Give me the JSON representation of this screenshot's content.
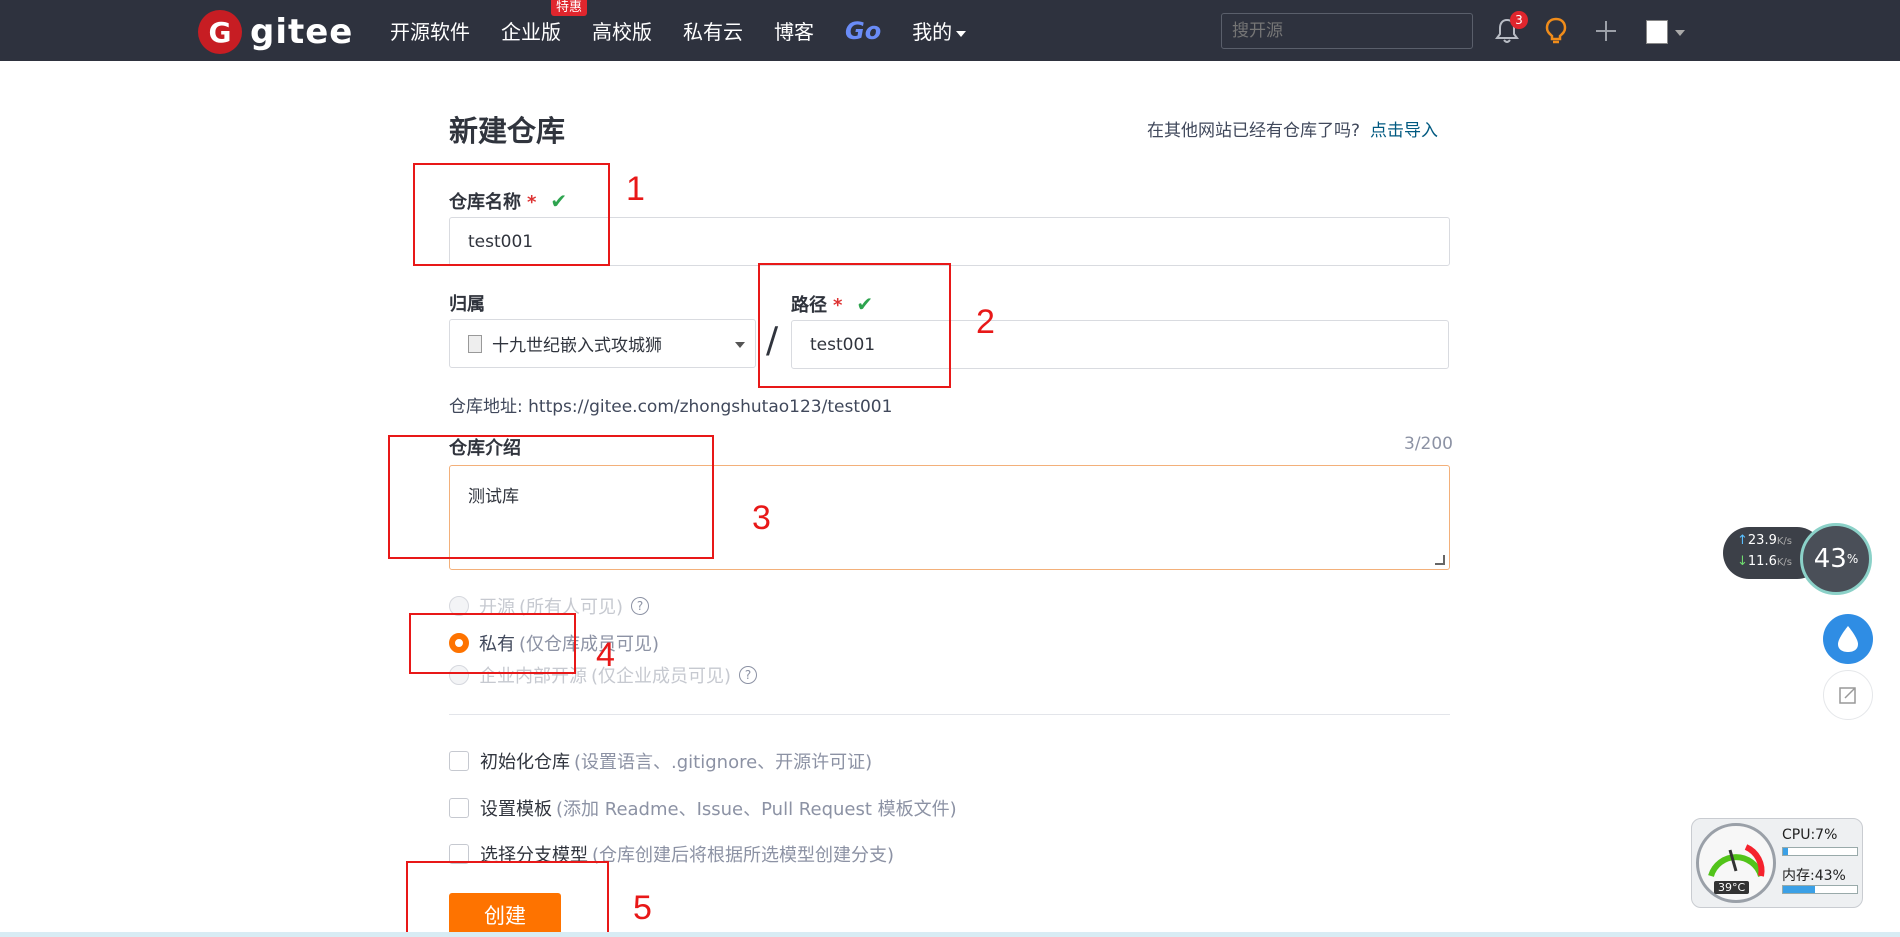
{
  "header": {
    "logo_letter": "G",
    "logo_text": "gitee",
    "nav": [
      {
        "label": "开源软件"
      },
      {
        "label": "企业版",
        "badge": "特惠"
      },
      {
        "label": "高校版"
      },
      {
        "label": "私有云"
      },
      {
        "label": "博客"
      },
      {
        "label": "Go"
      },
      {
        "label": "我的"
      }
    ],
    "search_placeholder": "搜开源",
    "notification_count": "3"
  },
  "form": {
    "title": "新建仓库",
    "import_prompt": "在其他网站已经有仓库了吗?",
    "import_link": "点击导入",
    "repo_name_label": "仓库名称",
    "required_mark": "*",
    "repo_name_value": "test001",
    "owner_label": "归属",
    "owner_value": "十九世纪嵌入式攻城狮",
    "path_label": "路径",
    "path_value": "test001",
    "slash": "/",
    "url_line": "仓库地址: https://gitee.com/zhongshutao123/test001",
    "desc_label": "仓库介绍",
    "desc_counter": "3/200",
    "desc_value": "测试库",
    "visibility": [
      {
        "label": "开源",
        "sub": "(所有人可见)",
        "disabled": true
      },
      {
        "label": "私有",
        "sub": "(仅仓库成员可见)",
        "selected": true
      },
      {
        "label": "企业内部开源",
        "sub": "(仅企业成员可见)",
        "disabled": true
      }
    ],
    "options": [
      {
        "label": "初始化仓库",
        "sub": "(设置语言、.gitignore、开源许可证)"
      },
      {
        "label": "设置模板",
        "sub": "(添加 Readme、Issue、Pull Request 模板文件)"
      },
      {
        "label": "选择分支模型",
        "sub": "(仓库创建后将根据所选模型创建分支)"
      }
    ],
    "create_button": "创建"
  },
  "annotations": [
    "1",
    "2",
    "3",
    "4",
    "5"
  ],
  "widgets": {
    "upload_speed": "23.9",
    "download_speed": "11.6",
    "speed_unit": "K/s",
    "net_percent": "43",
    "percent_sign": "%",
    "cpu": "CPU:7%",
    "memory": "内存:43%",
    "temperature": "39°C",
    "cpu_fraction": 0.07,
    "memory_fraction": 0.43
  },
  "colors": {
    "topbar": "#2e323e",
    "brand_red": "#c71d23",
    "accent_orange": "#fe7300",
    "link_blue": "#005980",
    "annotation_red": "#e81818"
  }
}
